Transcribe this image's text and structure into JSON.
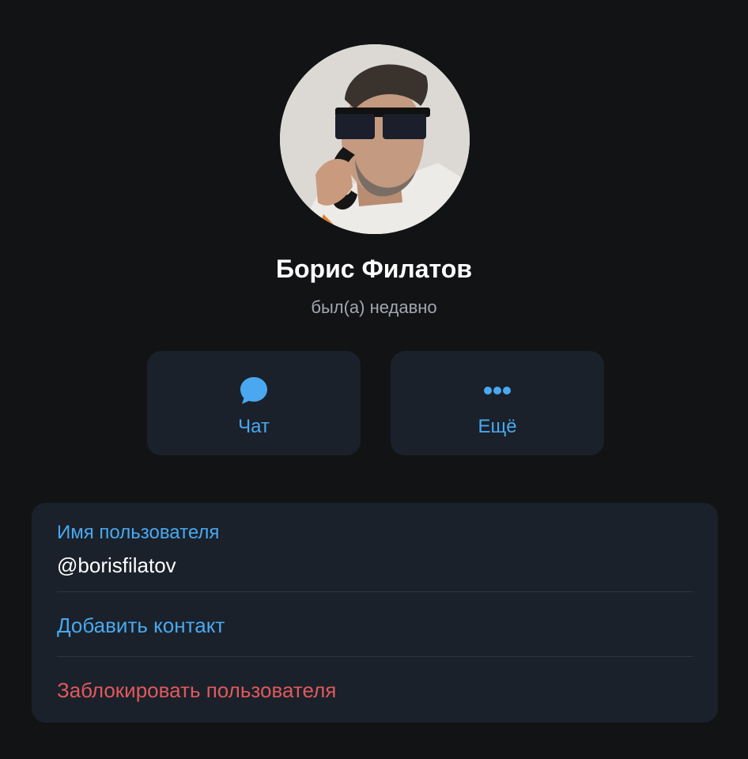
{
  "profile": {
    "name": "Борис Филатов",
    "status": "был(а) недавно"
  },
  "actions": {
    "chat_label": "Чат",
    "more_label": "Ещё"
  },
  "info": {
    "username_label": "Имя пользователя",
    "username_value": "@borisfilatov",
    "add_contact_label": "Добавить контакт",
    "block_user_label": "Заблокировать пользователя"
  },
  "colors": {
    "background": "#121315",
    "card": "#1a212a",
    "accent": "#4aa8f0",
    "danger": "#e0595c",
    "muted": "#a2a8b0"
  },
  "icons": {
    "chat": "chat-bubble-icon",
    "more": "more-dots-icon"
  }
}
